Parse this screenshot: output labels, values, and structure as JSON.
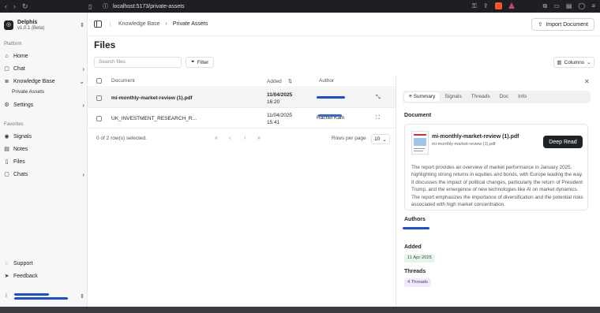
{
  "browser": {
    "url": "localhost:5173/private-assets"
  },
  "sidebar": {
    "app_name": "Delphis",
    "app_version": "v1.0.1 (Beta)",
    "platform_label": "Platform",
    "platform_items": [
      {
        "label": "Home",
        "icon": "home-icon"
      },
      {
        "label": "Chat",
        "icon": "chat-icon"
      },
      {
        "label": "Knowledge Base",
        "icon": "database-icon"
      }
    ],
    "sub_item": "Private Assets",
    "settings_label": "Settings",
    "favorites_label": "Favorites",
    "favorite_items": [
      {
        "label": "Signals",
        "icon": "signal-icon"
      },
      {
        "label": "Notes",
        "icon": "notes-icon"
      },
      {
        "label": "Files",
        "icon": "file-icon"
      },
      {
        "label": "Chats",
        "icon": "chat-icon"
      }
    ],
    "support_label": "Support",
    "feedback_label": "Feedback"
  },
  "header": {
    "breadcrumb": [
      "Knowledge Base",
      "Private Assets"
    ],
    "import_label": "Import Document"
  },
  "main": {
    "title": "Files",
    "search_placeholder": "Search files",
    "filter_label": "Filter",
    "columns_label": "Columns",
    "columns": {
      "document": "Document",
      "added": "Added",
      "author": "Author"
    },
    "rows": [
      {
        "name": "mi-monthly-market-review (1).pdf",
        "date": "11/04/2025",
        "time": "16:20",
        "author": "",
        "selected": true
      },
      {
        "name": "UK_INVESTMENT_RESEARCH_R...",
        "date": "11/04/2025",
        "time": "15:41",
        "author": "Rachel Kam",
        "selected": false
      }
    ],
    "selection_text": "0 of 2 row(s) selected.",
    "rows_per_page_label": "Rows per page",
    "rows_per_page_value": "10"
  },
  "panel": {
    "tabs": [
      "Summary",
      "Signals",
      "Threads",
      "Doc",
      "Info"
    ],
    "active_tab": "Summary",
    "document_heading": "Document",
    "doc_title": "mi-monthly-market-review (1).pdf",
    "doc_file": "mi-monthly-market-review (1).pdf",
    "deep_read_label": "Deep Read",
    "summary": "The report provides an overview of market performance in January 2025, highlighting strong returns in equities and bonds, with Europe leading the way. It discusses the impact of political changes, particularly the return of President Trump, and the emergence of new technologies like AI on market dynamics. The report emphasizes the importance of diversification and the potential risks associated with high market concentration.",
    "authors_heading": "Authors",
    "added_heading": "Added",
    "added_value": "11 Apr 2025",
    "threads_heading": "Threads",
    "threads_value": "4 Threads"
  },
  "colors": {
    "dark_button": "#1f2328",
    "redaction_blue": "#1a4fd6",
    "added_pill": "#e6f4ea",
    "threads_pill": "#efe9fb"
  }
}
